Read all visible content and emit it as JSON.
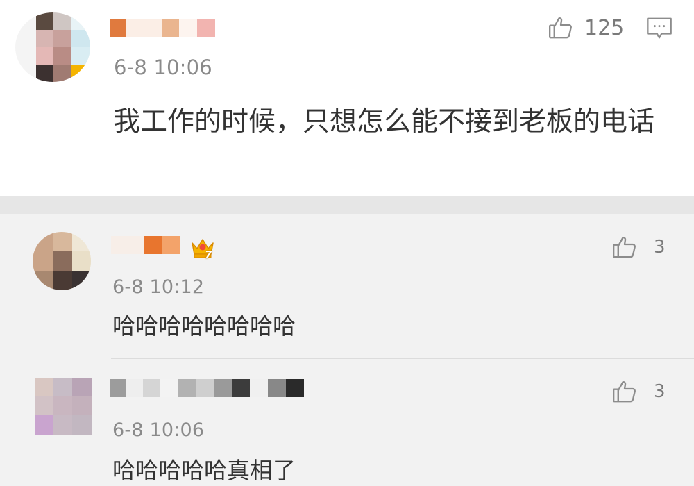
{
  "main_comment": {
    "time": "6-8 10:06",
    "like_count": "125",
    "text": "我工作的时候，只想怎么能不接到老板的电话",
    "icons": {
      "like": "thumbs-up-icon",
      "reply": "comment-icon"
    }
  },
  "replies": [
    {
      "time": "6-8 10:12",
      "like_count": "3",
      "text": "哈哈哈哈哈哈哈哈",
      "badge": "7",
      "icons": {
        "like": "thumbs-up-icon",
        "badge": "crown-badge-icon"
      }
    },
    {
      "time": "6-8 10:06",
      "like_count": "3",
      "text": "哈哈哈哈哈真相了",
      "icons": {
        "like": "thumbs-up-icon"
      }
    }
  ],
  "colors": {
    "main_bg": "#ffffff",
    "reply_bg": "#f2f2f2",
    "separator": "#e6e6e6",
    "text": "#333333",
    "meta": "#8a8a8a",
    "badge_gold": "#f0a500"
  }
}
